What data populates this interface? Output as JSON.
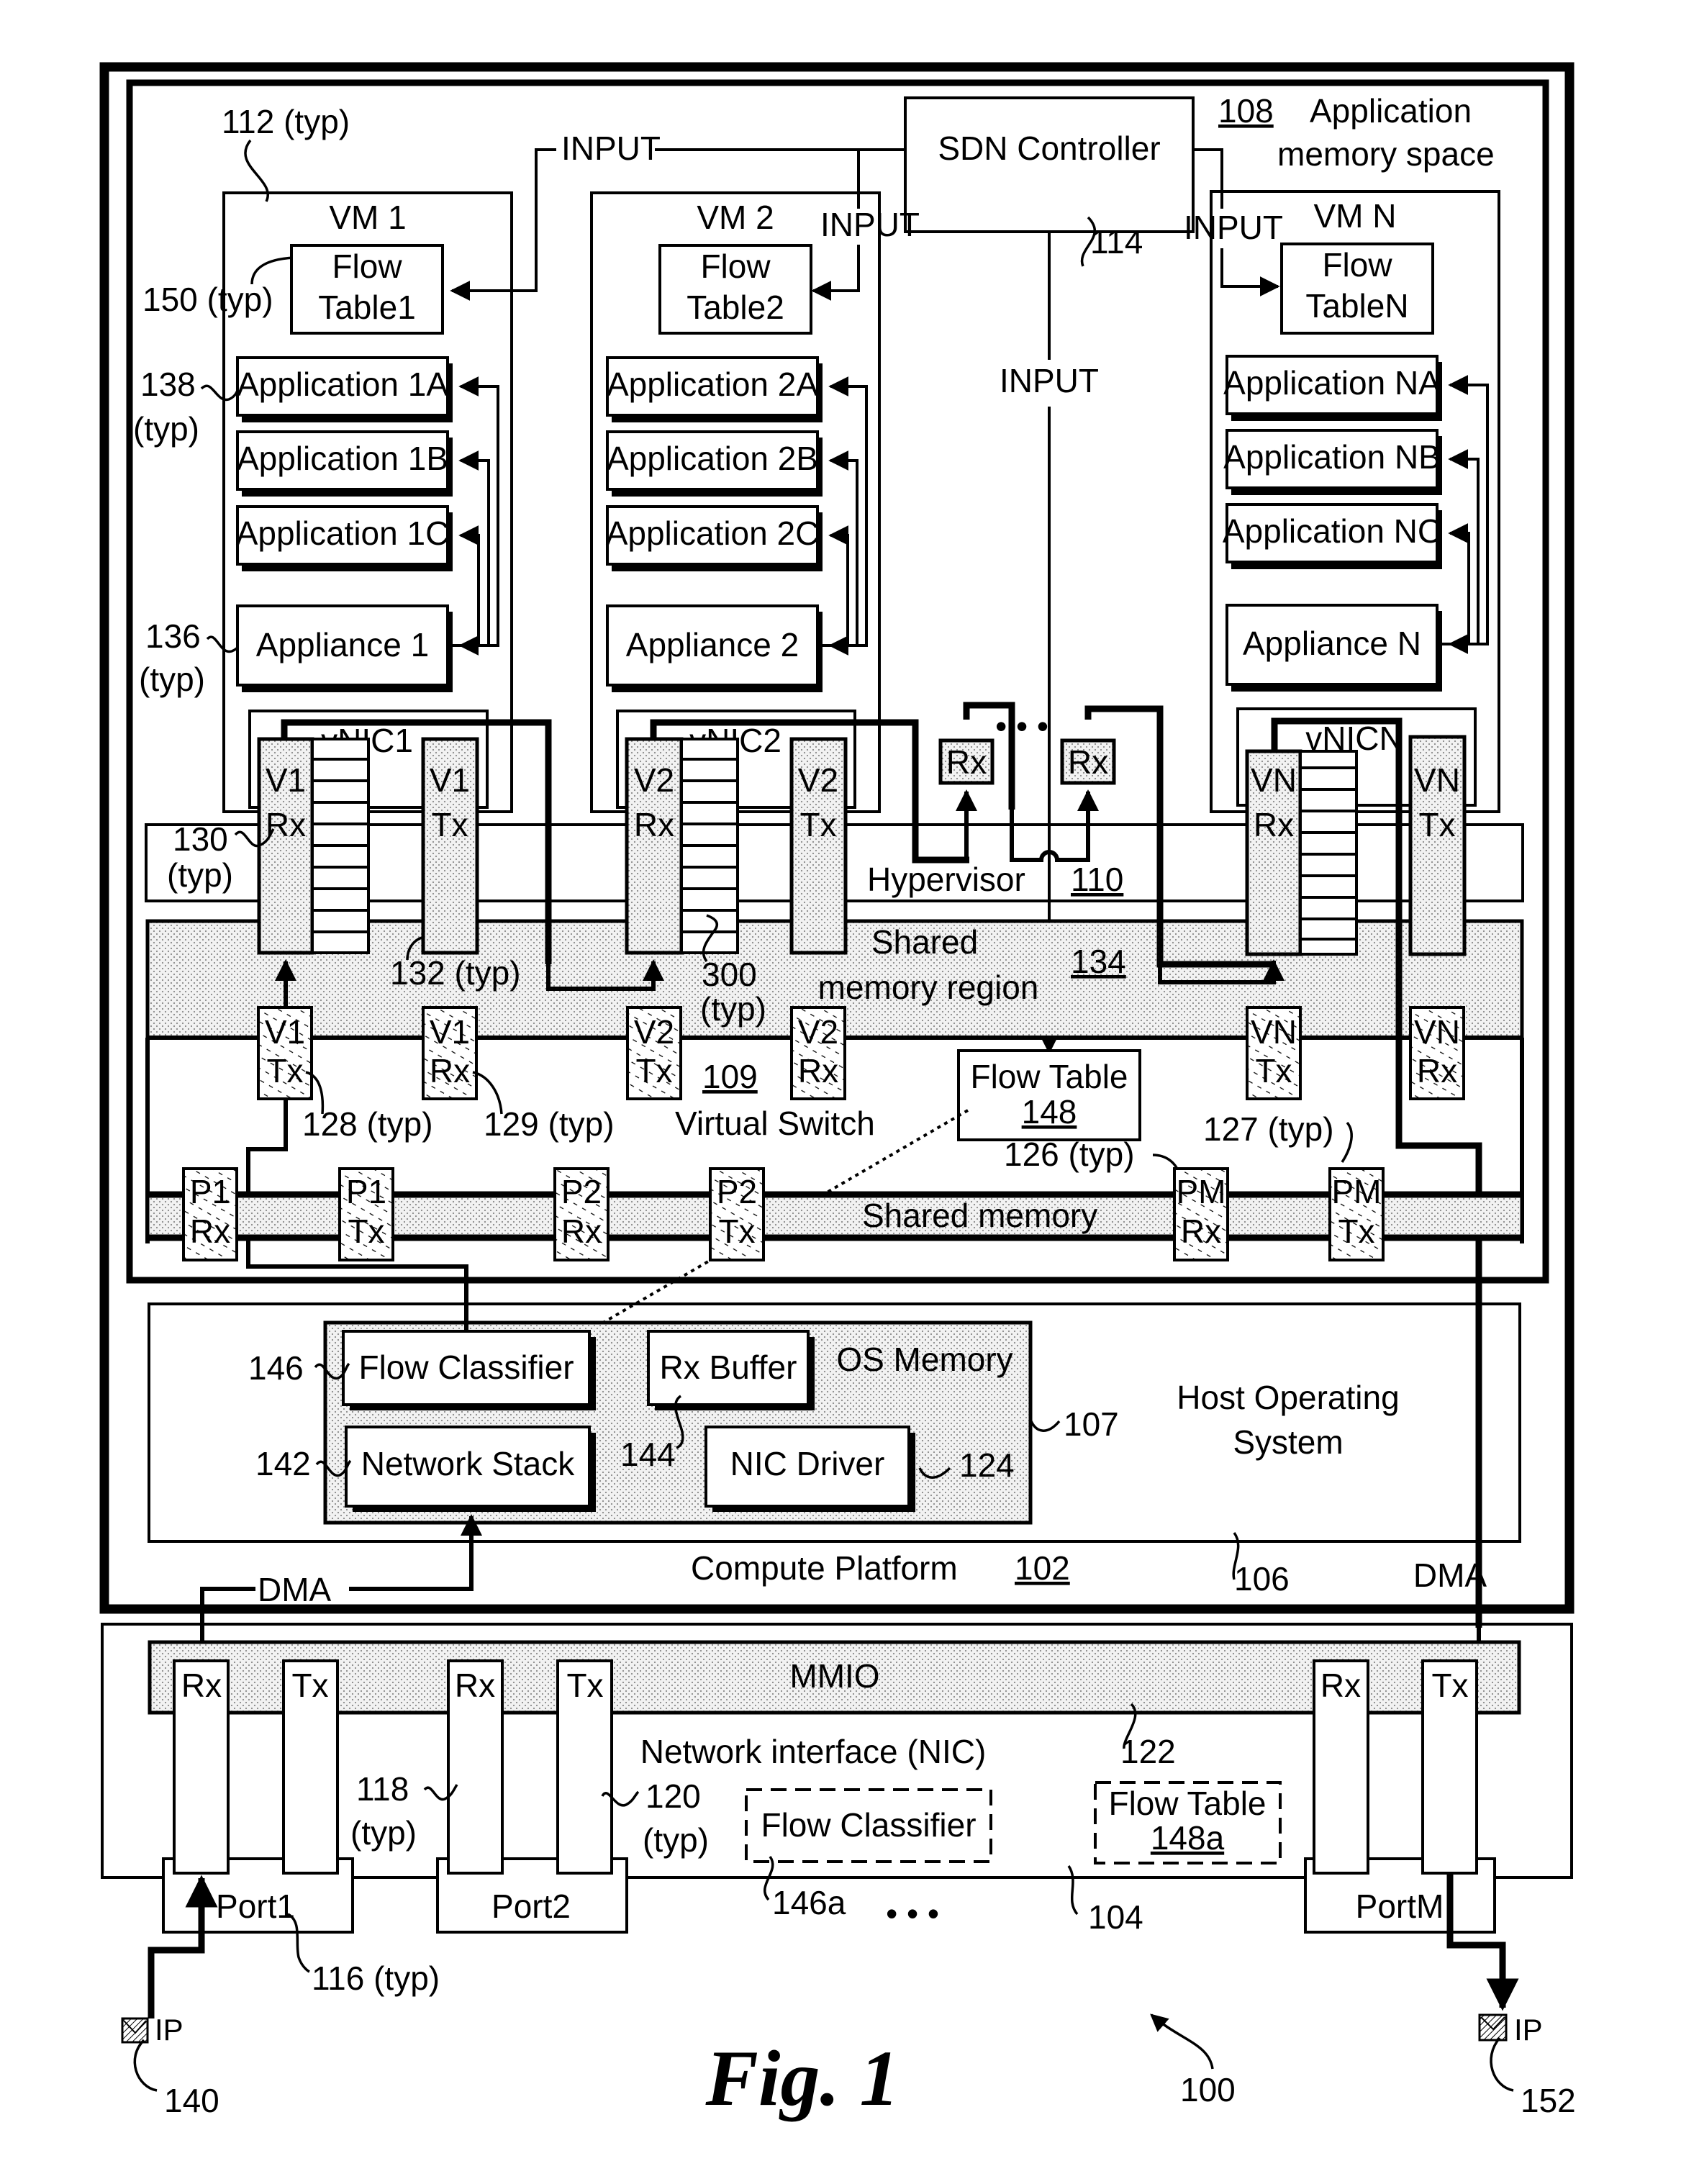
{
  "figure": {
    "caption": "Fig. 1",
    "ref_system": "100"
  },
  "compute_platform": {
    "label": "Compute Platform",
    "ref": "102",
    "ref_leader": "106"
  },
  "app_memory": {
    "ref": "108",
    "label_line1": "Application",
    "label_line2": "memory space"
  },
  "sdn_controller": {
    "label": "SDN Controller",
    "ref": "114"
  },
  "input_labels": {
    "top": "INPUT",
    "vm2": "INPUT",
    "vmn": "INPUT",
    "center": "INPUT"
  },
  "vm_refs": {
    "vm_typ": "112 (typ)",
    "flow_table_typ": "150 (typ)",
    "app_typ_num": "138",
    "app_typ": "(typ)",
    "appliance_typ_num": "136",
    "appliance_typ": "(typ)"
  },
  "vms": [
    {
      "title": "VM 1",
      "flow_table": [
        "Flow",
        "Table1"
      ],
      "apps": [
        "Application 1A",
        "Application 1B",
        "Application 1C"
      ],
      "appliance": "Appliance 1",
      "vnic": "vNIC1",
      "rx": [
        "V1",
        "Rx"
      ],
      "tx": [
        "V1",
        "Tx"
      ]
    },
    {
      "title": "VM 2",
      "flow_table": [
        "Flow",
        "Table2"
      ],
      "apps": [
        "Application 2A",
        "Application 2B",
        "Application 2C"
      ],
      "appliance": "Appliance 2",
      "vnic": "vNIC2",
      "rx": [
        "V2",
        "Rx"
      ],
      "tx": [
        "V2",
        "Tx"
      ]
    },
    {
      "title": "VM N",
      "flow_table": [
        "Flow",
        "TableN"
      ],
      "apps": [
        "Application NA",
        "Application NB",
        "Application NC"
      ],
      "appliance": "Appliance N",
      "vnic": "vNICN",
      "rx": [
        "VN",
        "Rx"
      ],
      "tx": [
        "VN",
        "Tx"
      ]
    }
  ],
  "hypervisor": {
    "label": "Hypervisor",
    "ref": "110",
    "rx_boxes": [
      "Rx",
      "Rx"
    ],
    "ellipsis": "• • •"
  },
  "shared_memory_region": {
    "line1": "Shared",
    "line2": "memory region",
    "ref": "134"
  },
  "refs": {
    "r130": "130",
    "r130b": "(typ)",
    "r132": "132 (typ)",
    "r300": "300",
    "r300b": "(typ)",
    "r128": "128 (typ)",
    "r129": "129 (typ)",
    "r127": "127 (typ)",
    "r126": "126 (typ)"
  },
  "virtual_switch": {
    "label": "Virtual Switch",
    "ref": "109",
    "vports": [
      [
        "V1",
        "Tx"
      ],
      [
        "V1",
        "Rx"
      ],
      [
        "V2",
        "Tx"
      ],
      [
        "V2",
        "Rx"
      ],
      [
        "VN",
        "Tx"
      ],
      [
        "VN",
        "Rx"
      ]
    ],
    "flow_table": {
      "label": "Flow Table",
      "ref": "148"
    }
  },
  "shared_memory": {
    "label": "Shared memory",
    "pports": [
      [
        "P1",
        "Rx"
      ],
      [
        "P1",
        "Tx"
      ],
      [
        "P2",
        "Rx"
      ],
      [
        "P2",
        "Tx"
      ],
      [
        "PM",
        "Rx"
      ],
      [
        "PM",
        "Tx"
      ]
    ]
  },
  "host_os": {
    "label_line1": "Host Operating",
    "label_line2": "System",
    "os_memory": "OS Memory",
    "os_memory_ref": "107",
    "flow_classifier": "Flow Classifier",
    "flow_classifier_ref": "146",
    "network_stack": "Network Stack",
    "network_stack_ref": "142",
    "rx_buffer": "Rx Buffer",
    "rx_buffer_ref": "144",
    "nic_driver": "NIC Driver",
    "nic_driver_ref": "124"
  },
  "dma": {
    "left": "DMA",
    "right": "DMA"
  },
  "nic": {
    "label": "Network interface (NIC)",
    "ref": "104",
    "mmio": "MMIO",
    "mmio_ref": "122",
    "queues": [
      "Rx",
      "Tx",
      "Rx",
      "Tx",
      "Rx",
      "Tx"
    ],
    "rx_queue_ref": "118",
    "rx_queue_typ": "(typ)",
    "tx_queue_ref": "120",
    "tx_queue_typ": "(typ)",
    "ports": [
      "Port1",
      "Port2",
      "PortM"
    ],
    "port_ref": "116 (typ)",
    "flow_classifier": "Flow Classifier",
    "flow_classifier_ref": "146a",
    "flow_table": "Flow Table",
    "flow_table_ref": "148a",
    "ellipsis": "• • •"
  },
  "packets": [
    {
      "label": "IP",
      "ref": "140"
    },
    {
      "label": "IP",
      "ref": "152"
    }
  ]
}
